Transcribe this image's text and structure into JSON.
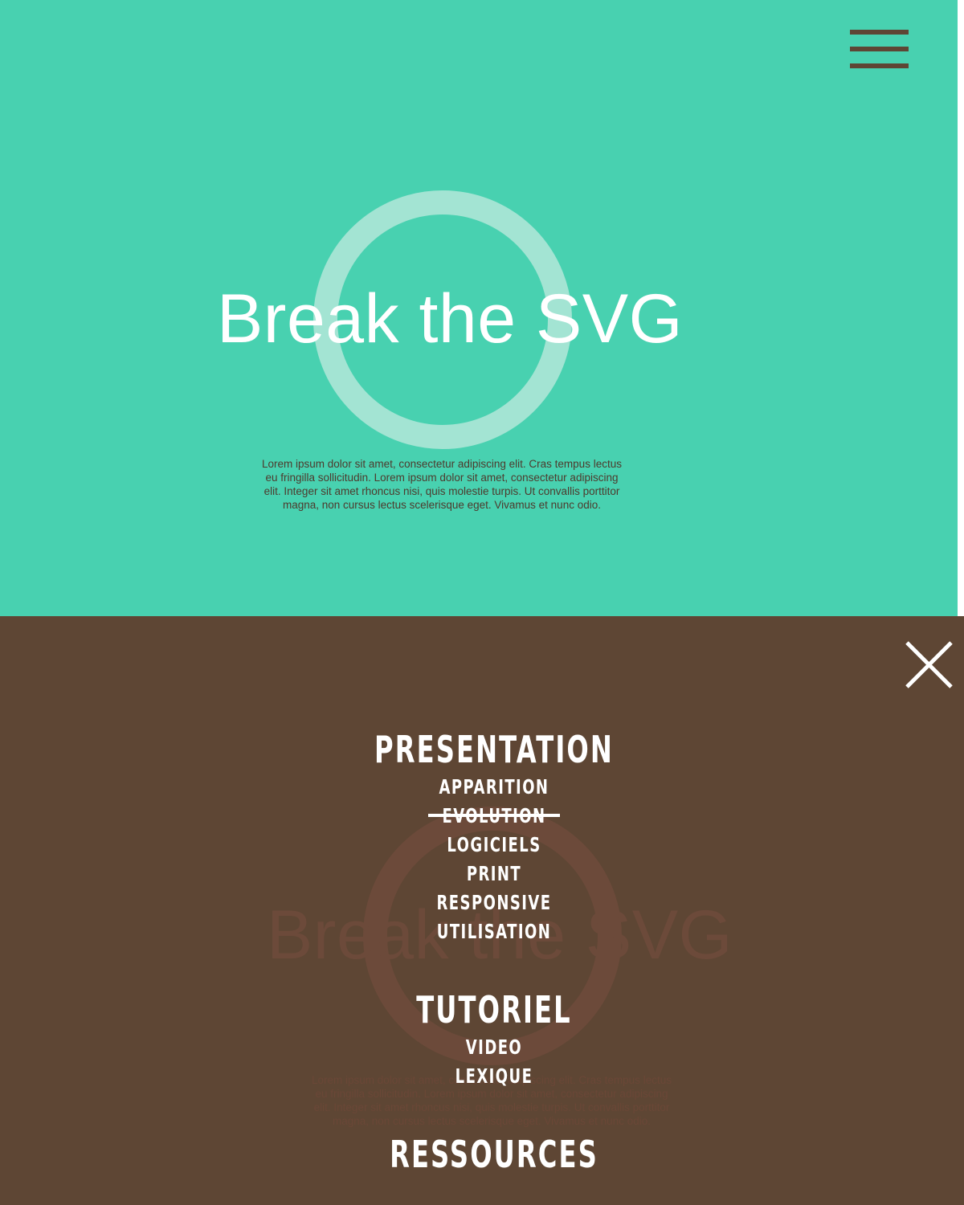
{
  "hero": {
    "title": "Break the SVG",
    "body": "Lorem ipsum dolor sit amet, consectetur adipiscing elit. Cras tempus lectus eu fringilla sollicitudin. Lorem ipsum dolor sit amet, consectetur adipiscing elit. Integer sit amet rhoncus nisi, quis molestie turpis. Ut convallis porttitor magna, non cursus lectus scelerisque eget. Vivamus et nunc odio."
  },
  "colors": {
    "hero_bg": "#48d1b0",
    "menu_bg": "#5e4634",
    "ring": "#a3e4d3",
    "menu_text": "#ffffff"
  },
  "icons": {
    "open_menu": "hamburger-icon",
    "close_menu": "close-icon"
  },
  "menu": {
    "sections": [
      {
        "label": "PRESENTATION",
        "items": [
          {
            "label": "APPARITION",
            "struck": false
          },
          {
            "label": "EVOLUTION",
            "struck": true
          },
          {
            "label": "LOGICIELS",
            "struck": false
          },
          {
            "label": "PRINT",
            "struck": false
          },
          {
            "label": "RESPONSIVE",
            "struck": false
          },
          {
            "label": "UTILISATION",
            "struck": false
          }
        ]
      },
      {
        "label": "TUTORIEL",
        "items": [
          {
            "label": "VIDEO",
            "struck": false
          },
          {
            "label": "LEXIQUE",
            "struck": false
          }
        ]
      },
      {
        "label": "RESSOURCES",
        "items": []
      }
    ]
  }
}
